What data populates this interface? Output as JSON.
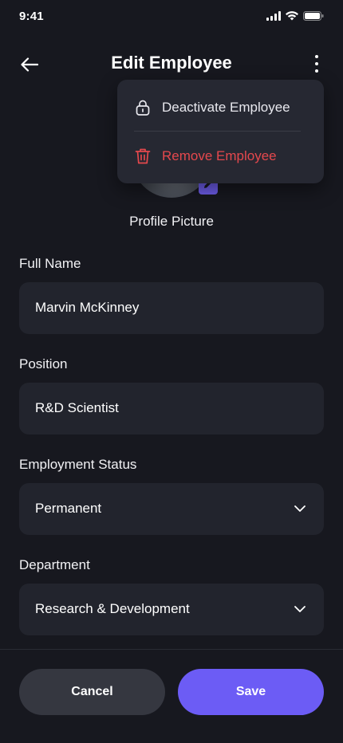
{
  "status_bar": {
    "time": "9:41"
  },
  "header": {
    "title": "Edit Employee"
  },
  "profile": {
    "label": "Profile Picture"
  },
  "menu": {
    "items": [
      {
        "label": "Deactivate Employee",
        "icon": "lock-icon",
        "color": "#e8e8ee"
      },
      {
        "label": "Remove Employee",
        "icon": "trash-icon",
        "color": "#e5484d"
      }
    ]
  },
  "form": {
    "full_name": {
      "label": "Full Name",
      "value": "Marvin McKinney"
    },
    "position": {
      "label": "Position",
      "value": "R&D Scientist"
    },
    "employment_status": {
      "label": "Employment Status",
      "value": "Permanent"
    },
    "department": {
      "label": "Department",
      "value": "Research & Development"
    }
  },
  "actions": {
    "cancel": "Cancel",
    "save": "Save"
  },
  "colors": {
    "accent": "#6c5cf5",
    "danger": "#e5484d",
    "background": "#17181f",
    "field": "#22242d"
  }
}
